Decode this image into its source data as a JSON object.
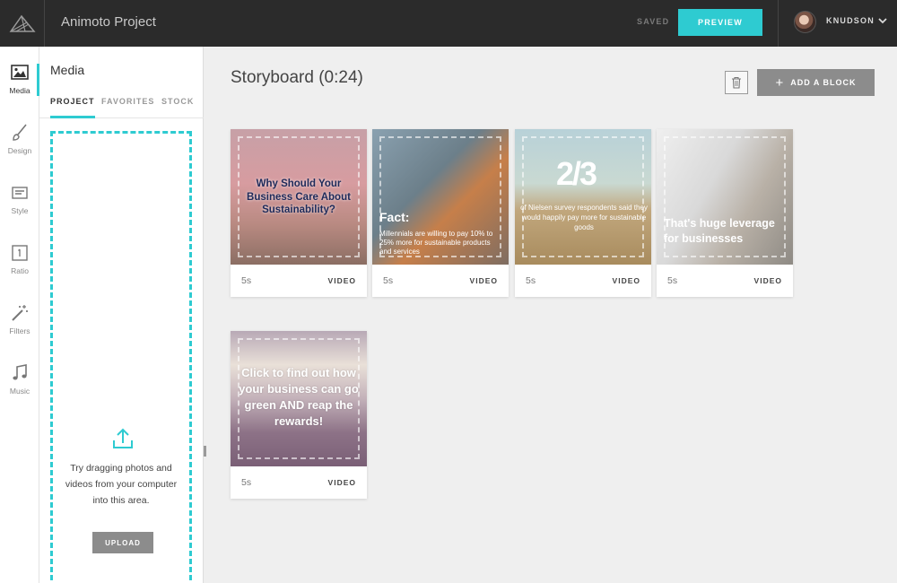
{
  "header": {
    "project_title": "Animoto Project",
    "saved_label": "SAVED",
    "preview_label": "PREVIEW",
    "username": "KNUDSON",
    "accent_color": "#2ecbd1"
  },
  "rail": {
    "items": [
      {
        "label": "Media",
        "icon": "image-icon"
      },
      {
        "label": "Design",
        "icon": "brush-icon"
      },
      {
        "label": "Style",
        "icon": "text-style-icon"
      },
      {
        "label": "Ratio",
        "icon": "ratio-icon"
      },
      {
        "label": "Filters",
        "icon": "magic-wand-icon"
      },
      {
        "label": "Music",
        "icon": "music-note-icon"
      }
    ],
    "active": "Media"
  },
  "media_panel": {
    "title": "Media",
    "tabs": [
      "PROJECT",
      "FAVORITES",
      "STOCK"
    ],
    "active_tab": "PROJECT",
    "dropzone_text": "Try dragging photos and videos from your computer into this area.",
    "upload_label": "UPLOAD"
  },
  "storyboard": {
    "title": "Storyboard (0:24)",
    "add_block_label": "ADD A BLOCK",
    "cards": [
      {
        "duration": "5s",
        "type": "VIDEO",
        "overlay": "Why Should Your Business Care About Sustainability?"
      },
      {
        "duration": "5s",
        "type": "VIDEO",
        "overlay": "Fact:",
        "overlay_sub": "Millennials are willing to pay 10% to 25% more for sustainable products and services"
      },
      {
        "duration": "5s",
        "type": "VIDEO",
        "overlay": "2/3",
        "overlay_sub": "of Nielsen survey respondents said they would happily pay more for sustainable goods"
      },
      {
        "duration": "5s",
        "type": "VIDEO",
        "overlay": "That's huge leverage for businesses"
      },
      {
        "duration": "5s",
        "type": "VIDEO",
        "overlay": "Click to find out how your business can go green AND reap the rewards!"
      }
    ]
  }
}
